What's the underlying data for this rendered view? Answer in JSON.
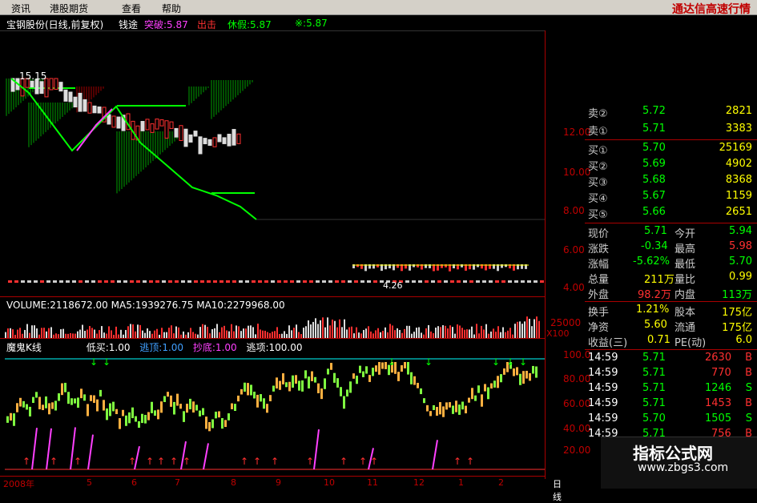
{
  "menu": {
    "items": [
      "资讯",
      "港股期货",
      "查看",
      "帮助"
    ],
    "brand": "通达信高速行情"
  },
  "title": {
    "stock": "宝钢股份(日线,前复权)",
    "indicator": "钱途",
    "tupo": "突破:5.87",
    "chuji": "出击",
    "xiujia": "休假:5.87",
    "extra": "※:5.87",
    "peak_label": "15.15",
    "low_label": "4.26"
  },
  "colors": {
    "up": "#ff3030",
    "down": "#00ff00",
    "axis": "#a00000",
    "magenta": "#ff40ff",
    "cyan": "#00ffff",
    "yellow": "#ffff00"
  },
  "price_axis": [
    "12.00",
    "10.00",
    "8.00",
    "6.00",
    "4.00"
  ],
  "volume": {
    "header": "VOLUME:2118672.00  MA5:1939276.75  MA10:2279968.00",
    "axis_label": "25000",
    "axis_unit": "X100"
  },
  "indicator_panel": {
    "name": "魔鬼K线",
    "buy_low": "低买:1.00",
    "escape": "逃顶:1.00",
    "bottom": "抄底:1.00",
    "top": "逃项:100.00",
    "axis": [
      "100.0",
      "80.00",
      "60.00",
      "40.00",
      "20.00"
    ]
  },
  "xaxis": {
    "labels": [
      "2008年",
      "5",
      "6",
      "7",
      "8",
      "9",
      "10",
      "11",
      "12",
      "1",
      "2"
    ],
    "period": "日线"
  },
  "quote": {
    "sell": [
      {
        "label": "卖②",
        "price": "5.72",
        "vol": "2821"
      },
      {
        "label": "卖①",
        "price": "5.71",
        "vol": "3383"
      }
    ],
    "buy": [
      {
        "label": "买①",
        "price": "5.70",
        "vol": "25169"
      },
      {
        "label": "买②",
        "price": "5.69",
        "vol": "4902"
      },
      {
        "label": "买③",
        "price": "5.68",
        "vol": "8368"
      },
      {
        "label": "买④",
        "price": "5.67",
        "vol": "1159"
      },
      {
        "label": "买⑤",
        "price": "5.66",
        "vol": "2651"
      }
    ],
    "stats": [
      {
        "k1": "现价",
        "v1": "5.71",
        "k2": "今开",
        "v2": "5.94"
      },
      {
        "k1": "涨跌",
        "v1": "-0.34",
        "k2": "最高",
        "v2": "5.98"
      },
      {
        "k1": "涨幅",
        "v1": "-5.62%",
        "k2": "最低",
        "v2": "5.70"
      },
      {
        "k1": "总量",
        "v1": "211万",
        "k2": "量比",
        "v2": "0.99"
      },
      {
        "k1": "外盘",
        "v1": "98.2万",
        "k2": "内盘",
        "v2": "113万"
      }
    ],
    "fin": [
      {
        "k1": "换手",
        "v1": "1.21%",
        "k2": "股本",
        "v2": "175亿"
      },
      {
        "k1": "净资",
        "v1": "5.60",
        "k2": "流通",
        "v2": "175亿"
      },
      {
        "k1": "收益(三)",
        "v1": "0.71",
        "k2": "PE(动)",
        "v2": "6.0"
      }
    ],
    "ticks": [
      {
        "time": "14:59",
        "price": "5.71",
        "vol": "2630",
        "dir": "B"
      },
      {
        "time": "14:59",
        "price": "5.71",
        "vol": "770",
        "dir": "B"
      },
      {
        "time": "14:59",
        "price": "5.71",
        "vol": "1246",
        "dir": "S"
      },
      {
        "time": "14:59",
        "price": "5.71",
        "vol": "1453",
        "dir": "B"
      },
      {
        "time": "14:59",
        "price": "5.70",
        "vol": "1505",
        "dir": "S"
      },
      {
        "time": "14:59",
        "price": "5.71",
        "vol": "756",
        "dir": "B"
      }
    ]
  },
  "watermark": {
    "title": "指标公式网",
    "url": "www.zbgs3.com"
  }
}
